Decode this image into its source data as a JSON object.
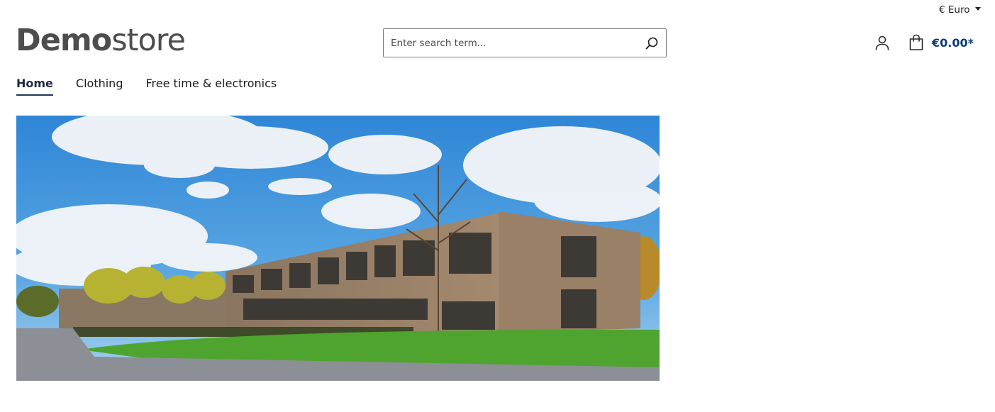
{
  "header": {
    "currency_label": "€ Euro",
    "logo_bold": "Demo",
    "logo_light": "store",
    "search_placeholder": "Enter search term...",
    "cart_total": "€0.00*"
  },
  "nav": {
    "items": [
      {
        "label": "Home",
        "active": true
      },
      {
        "label": "Clothing",
        "active": false
      },
      {
        "label": "Free time & electronics",
        "active": false
      }
    ]
  },
  "icons": {
    "search": "search-icon",
    "account": "user-icon",
    "cart": "shopping-bag-icon",
    "currency_caret": "caret-down-icon"
  },
  "colors": {
    "accent": "#0b3a78",
    "nav_underline": "#1e3a5f",
    "logo": "#4d4d4d"
  }
}
